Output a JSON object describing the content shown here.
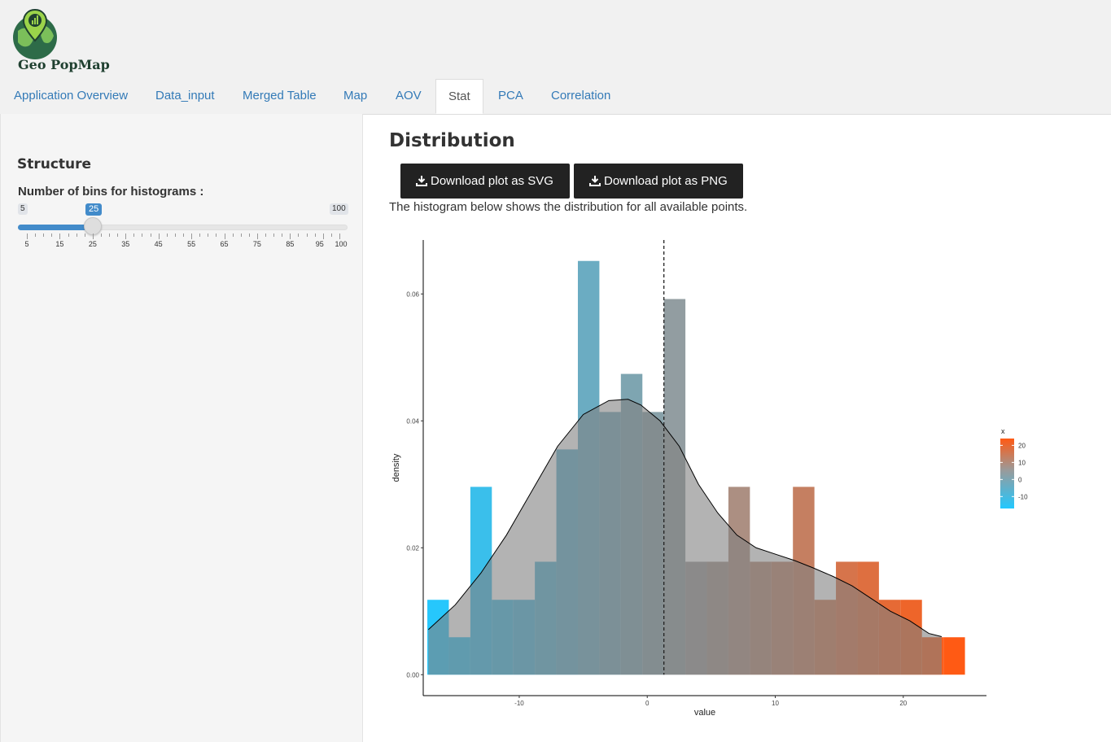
{
  "app": {
    "logo_text": "Geo PopMap"
  },
  "tabs": [
    {
      "label": "Application Overview"
    },
    {
      "label": "Data_input"
    },
    {
      "label": "Merged Table"
    },
    {
      "label": "Map"
    },
    {
      "label": "AOV"
    },
    {
      "label": "Stat"
    },
    {
      "label": "PCA"
    },
    {
      "label": "Correlation"
    }
  ],
  "active_tab": "Stat",
  "sidebar": {
    "title": "Structure",
    "slider": {
      "label": "Number of bins for histograms :",
      "min": 5,
      "max": 100,
      "value": 25,
      "min_label": "5",
      "max_label": "100",
      "value_label": "25",
      "ticks": [
        "5",
        "15",
        "25",
        "35",
        "45",
        "55",
        "65",
        "75",
        "85",
        "95",
        "100"
      ]
    }
  },
  "main": {
    "title": "Distribution",
    "download_svg_label": "Download plot as SVG",
    "download_png_label": "Download plot as PNG",
    "description": "The histogram below shows the distribution for all available points."
  },
  "colors": {
    "low": "#22c8ff",
    "mid": "#9a9a9a",
    "high": "#ff5a14",
    "button": "#222222",
    "link": "#337ab7"
  },
  "chart_data": {
    "type": "bar",
    "xlabel": "value",
    "ylabel": "density",
    "xlim": [
      -17.5,
      26.5
    ],
    "ylim": [
      -0.0033,
      0.0685
    ],
    "x_ticks": [
      -10,
      0,
      10,
      20
    ],
    "y_ticks": [
      0.0,
      0.02,
      0.04,
      0.06
    ],
    "y_tick_labels": [
      "0.00",
      "0.02",
      "0.04",
      "0.06"
    ],
    "bin_width": 1.68,
    "bins": [
      {
        "x": -16.34,
        "density": 0.0118
      },
      {
        "x": -14.66,
        "density": 0.0059
      },
      {
        "x": -12.98,
        "density": 0.0296
      },
      {
        "x": -11.3,
        "density": 0.0118
      },
      {
        "x": -9.62,
        "density": 0.0118
      },
      {
        "x": -7.94,
        "density": 0.0178
      },
      {
        "x": -6.26,
        "density": 0.0355
      },
      {
        "x": -4.58,
        "density": 0.0652
      },
      {
        "x": -2.9,
        "density": 0.0414
      },
      {
        "x": -1.22,
        "density": 0.0474
      },
      {
        "x": 0.46,
        "density": 0.0414
      },
      {
        "x": 2.14,
        "density": 0.0592
      },
      {
        "x": 3.82,
        "density": 0.0178
      },
      {
        "x": 5.5,
        "density": 0.0178
      },
      {
        "x": 7.18,
        "density": 0.0296
      },
      {
        "x": 8.86,
        "density": 0.0178
      },
      {
        "x": 10.54,
        "density": 0.0178
      },
      {
        "x": 12.22,
        "density": 0.0296
      },
      {
        "x": 13.9,
        "density": 0.0118
      },
      {
        "x": 15.58,
        "density": 0.0178
      },
      {
        "x": 17.26,
        "density": 0.0178
      },
      {
        "x": 18.94,
        "density": 0.0118
      },
      {
        "x": 20.62,
        "density": 0.0118
      },
      {
        "x": 22.3,
        "density": 0.0059
      },
      {
        "x": 23.98,
        "density": 0.0059
      }
    ],
    "density_curve": {
      "x": [
        -17.1,
        -15,
        -13,
        -11,
        -9,
        -7,
        -5,
        -3,
        -1.5,
        -0.5,
        1,
        2.5,
        4,
        5.5,
        7,
        8.5,
        10,
        11.5,
        13,
        14.5,
        16,
        17.5,
        19,
        20.5,
        22,
        23
      ],
      "y": [
        0.0071,
        0.011,
        0.016,
        0.022,
        0.029,
        0.036,
        0.041,
        0.0432,
        0.0434,
        0.0425,
        0.04,
        0.036,
        0.03,
        0.0255,
        0.022,
        0.02,
        0.019,
        0.018,
        0.0168,
        0.0155,
        0.014,
        0.012,
        0.01,
        0.0085,
        0.0065,
        0.006
      ]
    },
    "reference_line": {
      "x": 1.3,
      "style": "dashed"
    },
    "color_scale": {
      "title": "x",
      "labels": [
        "20",
        "10",
        "0",
        "-10"
      ],
      "low": "#22c8ff",
      "mid": "#9a9a9a",
      "high": "#ff5a14",
      "range": [
        -17,
        24
      ]
    }
  }
}
